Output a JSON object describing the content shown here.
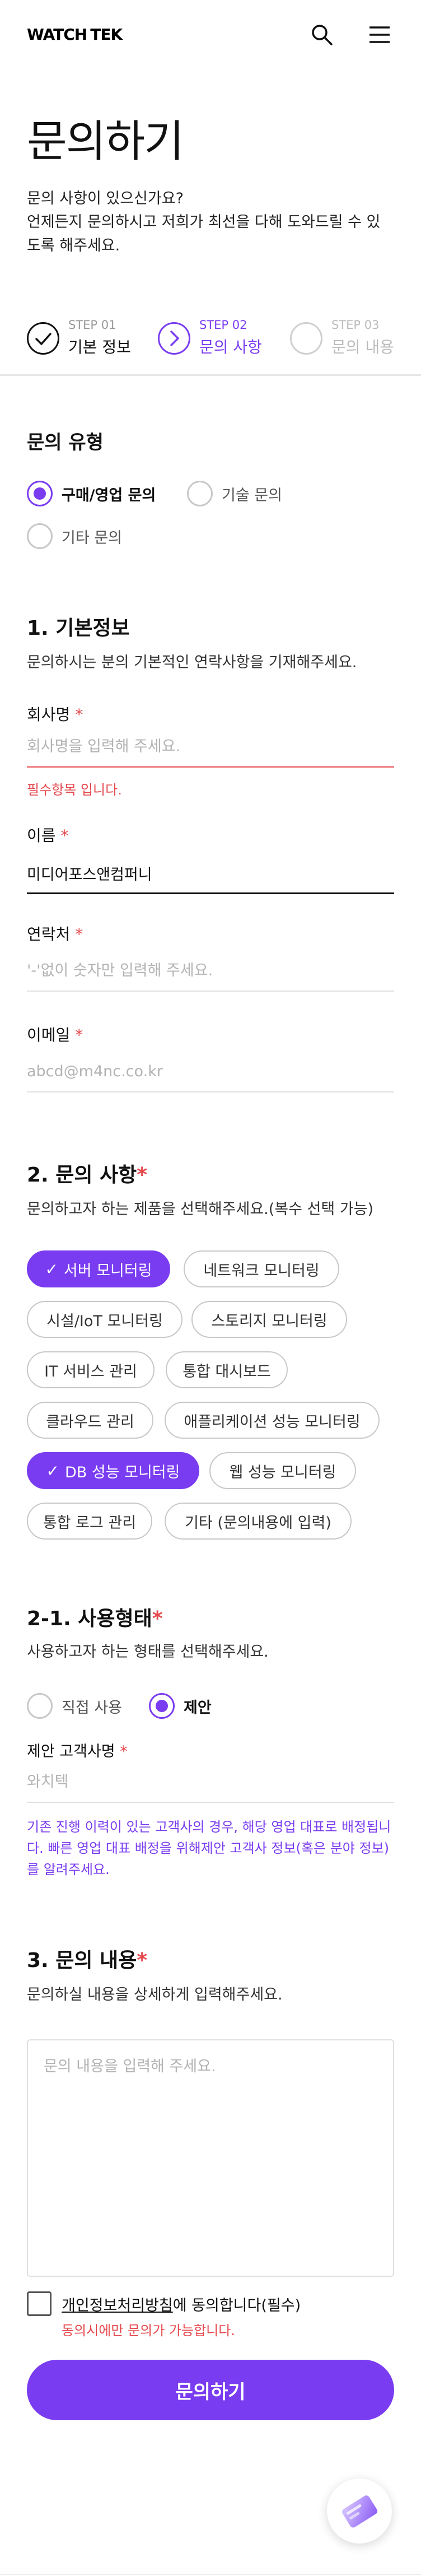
{
  "header": {
    "logo_watch": "WATCH",
    "logo_tek": "TEK",
    "search_icon": "search-icon",
    "menu_icon": "hamburger-menu-icon"
  },
  "page": {
    "title": "문의하기",
    "desc_line1": "문의 사항이 있으신가요?",
    "desc_line2": "언제든지 문의하시고 저희가 최선을 다해 도와드릴 수 있",
    "desc_line3": "도록 해주세요."
  },
  "steps": [
    {
      "no": "STEP 01",
      "name": "기본 정보",
      "state": "done"
    },
    {
      "no": "STEP 02",
      "name": "문의 사항",
      "state": "current"
    },
    {
      "no": "STEP 03",
      "name": "문의 내용",
      "state": "upcoming"
    }
  ],
  "inquiry_type": {
    "title": "문의 유형",
    "options": [
      "구매/영업 문의",
      "기술 문의",
      "기타 문의"
    ],
    "selected": "구매/영업 문의"
  },
  "basic_info": {
    "title": "1. 기본정보",
    "desc": "문의하시는 분의 기본적인 연락사항을 기재해주세요.",
    "company": {
      "label": "회사명",
      "required_mark": "*",
      "placeholder": "회사명을 입력해 주세요.",
      "value": "",
      "error": "필수항목 입니다."
    },
    "name": {
      "label": "이름",
      "required_mark": "*",
      "placeholder": "",
      "value": "미디어포스앤컴퍼니"
    },
    "phone": {
      "label": "연락처",
      "required_mark": "*",
      "placeholder": "'-'없이 숫자만 입력해 주세요.",
      "value": ""
    },
    "email": {
      "label": "이메일",
      "required_mark": "*",
      "placeholder": "abcd@m4nc.co.kr",
      "value": ""
    }
  },
  "inquiry_items": {
    "title": "2. 문의 사항",
    "required_mark": "*",
    "desc": "문의하고자 하는 제품을 선택해주세요.(복수 선택 가능)",
    "chips": [
      {
        "label": "서버 모니터링",
        "selected": true
      },
      {
        "label": "네트워크 모니터링",
        "selected": false
      },
      {
        "label": "시설/IoT 모니터링",
        "selected": false
      },
      {
        "label": "스토리지 모니터링",
        "selected": false
      },
      {
        "label": "IT 서비스 관리",
        "selected": false
      },
      {
        "label": "통합 대시보드",
        "selected": false
      },
      {
        "label": "클라우드 관리",
        "selected": false
      },
      {
        "label": "애플리케이션 성능 모니터링",
        "selected": false
      },
      {
        "label": "DB 성능 모니터링",
        "selected": true
      },
      {
        "label": "웹 성능 모니터링",
        "selected": false
      },
      {
        "label": "통합 로그 관리",
        "selected": false
      },
      {
        "label": "기타 (문의내용에 입력)",
        "selected": false
      }
    ]
  },
  "usage": {
    "title": "2-1. 사용형태",
    "required_mark": "*",
    "desc": "사용하고자 하는 형태를 선택해주세요.",
    "options": [
      "직접 사용",
      "제안"
    ],
    "selected": "제안",
    "client": {
      "label": "제안 고객사명",
      "required_mark": "*",
      "placeholder": "와치텍",
      "value": ""
    },
    "note_line1": "기존 진행 이력이 있는 고객사의 경우, 해당 영업 대표로 배정됩니",
    "note_line2": "다. 빠른 영업 대표 배정을 위해제안 고객사 정보(혹은 분야 정보)",
    "note_line3": "를 알려주세요."
  },
  "content": {
    "title": "3. 문의 내용",
    "required_mark": "*",
    "desc": "문의하실 내용을 상세하게 입력해주세요.",
    "placeholder": "문의 내용을 입력해 주세요.",
    "value": ""
  },
  "agreement": {
    "link_text": "개인정보처리방침",
    "rest_text": "에 동의합니다(필수)",
    "sub_text": "동의시에만 문의가 가능합니다.",
    "checked": false
  },
  "submit_label": "문의하기",
  "colors": {
    "accent": "#7a3cf0",
    "error": "#e5484d"
  }
}
